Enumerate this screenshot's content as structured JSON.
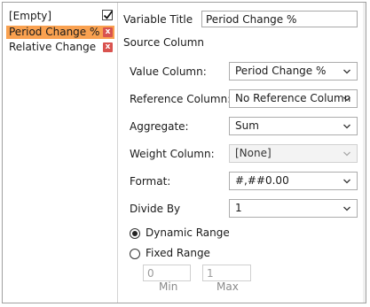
{
  "variables": {
    "items": [
      {
        "label": "[Empty]",
        "checked": true
      },
      {
        "label": "Period Change %",
        "selected": true,
        "delete_glyph": "x"
      },
      {
        "label": "Relative Change",
        "delete_glyph": "x"
      }
    ]
  },
  "form": {
    "variable_title_label": "Variable Title",
    "variable_title_value": "Period Change %",
    "source_column_label": "Source Column",
    "value_column": {
      "label": "Value Column:",
      "value": "Period Change %"
    },
    "reference_column": {
      "label": "Reference Column:",
      "value": "No Reference Column"
    },
    "aggregate": {
      "label": "Aggregate:",
      "value": "Sum"
    },
    "weight_column": {
      "label": "Weight Column:",
      "value": "[None]"
    },
    "format": {
      "label": "Format:",
      "value": "#,##0.00"
    },
    "divide_by": {
      "label": "Divide By",
      "value": "1"
    },
    "range": {
      "dynamic_label": "Dynamic Range",
      "dynamic_selected": true,
      "fixed_label": "Fixed Range",
      "min_value": "0",
      "max_value": "1",
      "min_label": "Min",
      "max_label": "Max"
    }
  },
  "colors": {
    "selected_item": "#f9a150",
    "delete_button": "#d9534f"
  }
}
